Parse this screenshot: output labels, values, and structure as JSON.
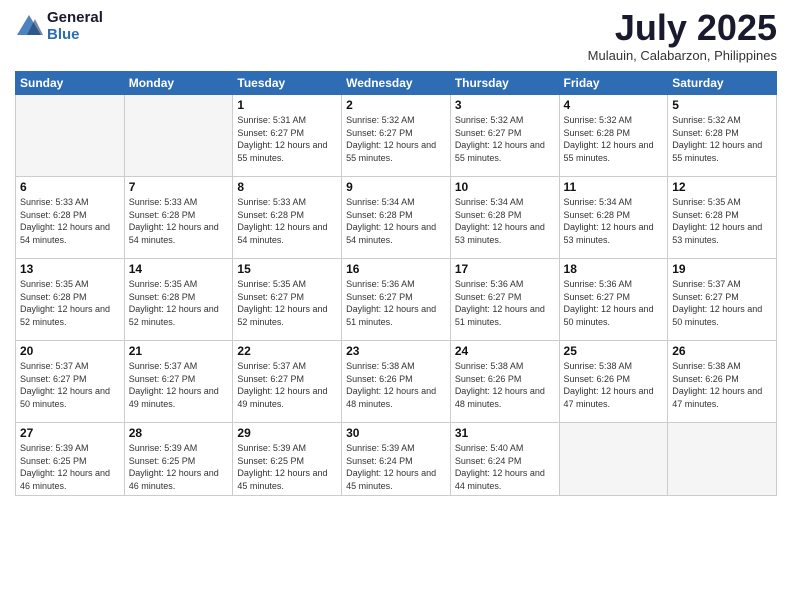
{
  "logo": {
    "general": "General",
    "blue": "Blue"
  },
  "header": {
    "month": "July 2025",
    "location": "Mulauin, Calabarzon, Philippines"
  },
  "weekdays": [
    "Sunday",
    "Monday",
    "Tuesday",
    "Wednesday",
    "Thursday",
    "Friday",
    "Saturday"
  ],
  "weeks": [
    [
      {
        "day": "",
        "sunrise": "",
        "sunset": "",
        "daylight": ""
      },
      {
        "day": "",
        "sunrise": "",
        "sunset": "",
        "daylight": ""
      },
      {
        "day": "1",
        "sunrise": "Sunrise: 5:31 AM",
        "sunset": "Sunset: 6:27 PM",
        "daylight": "Daylight: 12 hours and 55 minutes."
      },
      {
        "day": "2",
        "sunrise": "Sunrise: 5:32 AM",
        "sunset": "Sunset: 6:27 PM",
        "daylight": "Daylight: 12 hours and 55 minutes."
      },
      {
        "day": "3",
        "sunrise": "Sunrise: 5:32 AM",
        "sunset": "Sunset: 6:27 PM",
        "daylight": "Daylight: 12 hours and 55 minutes."
      },
      {
        "day": "4",
        "sunrise": "Sunrise: 5:32 AM",
        "sunset": "Sunset: 6:28 PM",
        "daylight": "Daylight: 12 hours and 55 minutes."
      },
      {
        "day": "5",
        "sunrise": "Sunrise: 5:32 AM",
        "sunset": "Sunset: 6:28 PM",
        "daylight": "Daylight: 12 hours and 55 minutes."
      }
    ],
    [
      {
        "day": "6",
        "sunrise": "Sunrise: 5:33 AM",
        "sunset": "Sunset: 6:28 PM",
        "daylight": "Daylight: 12 hours and 54 minutes."
      },
      {
        "day": "7",
        "sunrise": "Sunrise: 5:33 AM",
        "sunset": "Sunset: 6:28 PM",
        "daylight": "Daylight: 12 hours and 54 minutes."
      },
      {
        "day": "8",
        "sunrise": "Sunrise: 5:33 AM",
        "sunset": "Sunset: 6:28 PM",
        "daylight": "Daylight: 12 hours and 54 minutes."
      },
      {
        "day": "9",
        "sunrise": "Sunrise: 5:34 AM",
        "sunset": "Sunset: 6:28 PM",
        "daylight": "Daylight: 12 hours and 54 minutes."
      },
      {
        "day": "10",
        "sunrise": "Sunrise: 5:34 AM",
        "sunset": "Sunset: 6:28 PM",
        "daylight": "Daylight: 12 hours and 53 minutes."
      },
      {
        "day": "11",
        "sunrise": "Sunrise: 5:34 AM",
        "sunset": "Sunset: 6:28 PM",
        "daylight": "Daylight: 12 hours and 53 minutes."
      },
      {
        "day": "12",
        "sunrise": "Sunrise: 5:35 AM",
        "sunset": "Sunset: 6:28 PM",
        "daylight": "Daylight: 12 hours and 53 minutes."
      }
    ],
    [
      {
        "day": "13",
        "sunrise": "Sunrise: 5:35 AM",
        "sunset": "Sunset: 6:28 PM",
        "daylight": "Daylight: 12 hours and 52 minutes."
      },
      {
        "day": "14",
        "sunrise": "Sunrise: 5:35 AM",
        "sunset": "Sunset: 6:28 PM",
        "daylight": "Daylight: 12 hours and 52 minutes."
      },
      {
        "day": "15",
        "sunrise": "Sunrise: 5:35 AM",
        "sunset": "Sunset: 6:27 PM",
        "daylight": "Daylight: 12 hours and 52 minutes."
      },
      {
        "day": "16",
        "sunrise": "Sunrise: 5:36 AM",
        "sunset": "Sunset: 6:27 PM",
        "daylight": "Daylight: 12 hours and 51 minutes."
      },
      {
        "day": "17",
        "sunrise": "Sunrise: 5:36 AM",
        "sunset": "Sunset: 6:27 PM",
        "daylight": "Daylight: 12 hours and 51 minutes."
      },
      {
        "day": "18",
        "sunrise": "Sunrise: 5:36 AM",
        "sunset": "Sunset: 6:27 PM",
        "daylight": "Daylight: 12 hours and 50 minutes."
      },
      {
        "day": "19",
        "sunrise": "Sunrise: 5:37 AM",
        "sunset": "Sunset: 6:27 PM",
        "daylight": "Daylight: 12 hours and 50 minutes."
      }
    ],
    [
      {
        "day": "20",
        "sunrise": "Sunrise: 5:37 AM",
        "sunset": "Sunset: 6:27 PM",
        "daylight": "Daylight: 12 hours and 50 minutes."
      },
      {
        "day": "21",
        "sunrise": "Sunrise: 5:37 AM",
        "sunset": "Sunset: 6:27 PM",
        "daylight": "Daylight: 12 hours and 49 minutes."
      },
      {
        "day": "22",
        "sunrise": "Sunrise: 5:37 AM",
        "sunset": "Sunset: 6:27 PM",
        "daylight": "Daylight: 12 hours and 49 minutes."
      },
      {
        "day": "23",
        "sunrise": "Sunrise: 5:38 AM",
        "sunset": "Sunset: 6:26 PM",
        "daylight": "Daylight: 12 hours and 48 minutes."
      },
      {
        "day": "24",
        "sunrise": "Sunrise: 5:38 AM",
        "sunset": "Sunset: 6:26 PM",
        "daylight": "Daylight: 12 hours and 48 minutes."
      },
      {
        "day": "25",
        "sunrise": "Sunrise: 5:38 AM",
        "sunset": "Sunset: 6:26 PM",
        "daylight": "Daylight: 12 hours and 47 minutes."
      },
      {
        "day": "26",
        "sunrise": "Sunrise: 5:38 AM",
        "sunset": "Sunset: 6:26 PM",
        "daylight": "Daylight: 12 hours and 47 minutes."
      }
    ],
    [
      {
        "day": "27",
        "sunrise": "Sunrise: 5:39 AM",
        "sunset": "Sunset: 6:25 PM",
        "daylight": "Daylight: 12 hours and 46 minutes."
      },
      {
        "day": "28",
        "sunrise": "Sunrise: 5:39 AM",
        "sunset": "Sunset: 6:25 PM",
        "daylight": "Daylight: 12 hours and 46 minutes."
      },
      {
        "day": "29",
        "sunrise": "Sunrise: 5:39 AM",
        "sunset": "Sunset: 6:25 PM",
        "daylight": "Daylight: 12 hours and 45 minutes."
      },
      {
        "day": "30",
        "sunrise": "Sunrise: 5:39 AM",
        "sunset": "Sunset: 6:24 PM",
        "daylight": "Daylight: 12 hours and 45 minutes."
      },
      {
        "day": "31",
        "sunrise": "Sunrise: 5:40 AM",
        "sunset": "Sunset: 6:24 PM",
        "daylight": "Daylight: 12 hours and 44 minutes."
      },
      {
        "day": "",
        "sunrise": "",
        "sunset": "",
        "daylight": ""
      },
      {
        "day": "",
        "sunrise": "",
        "sunset": "",
        "daylight": ""
      }
    ]
  ]
}
